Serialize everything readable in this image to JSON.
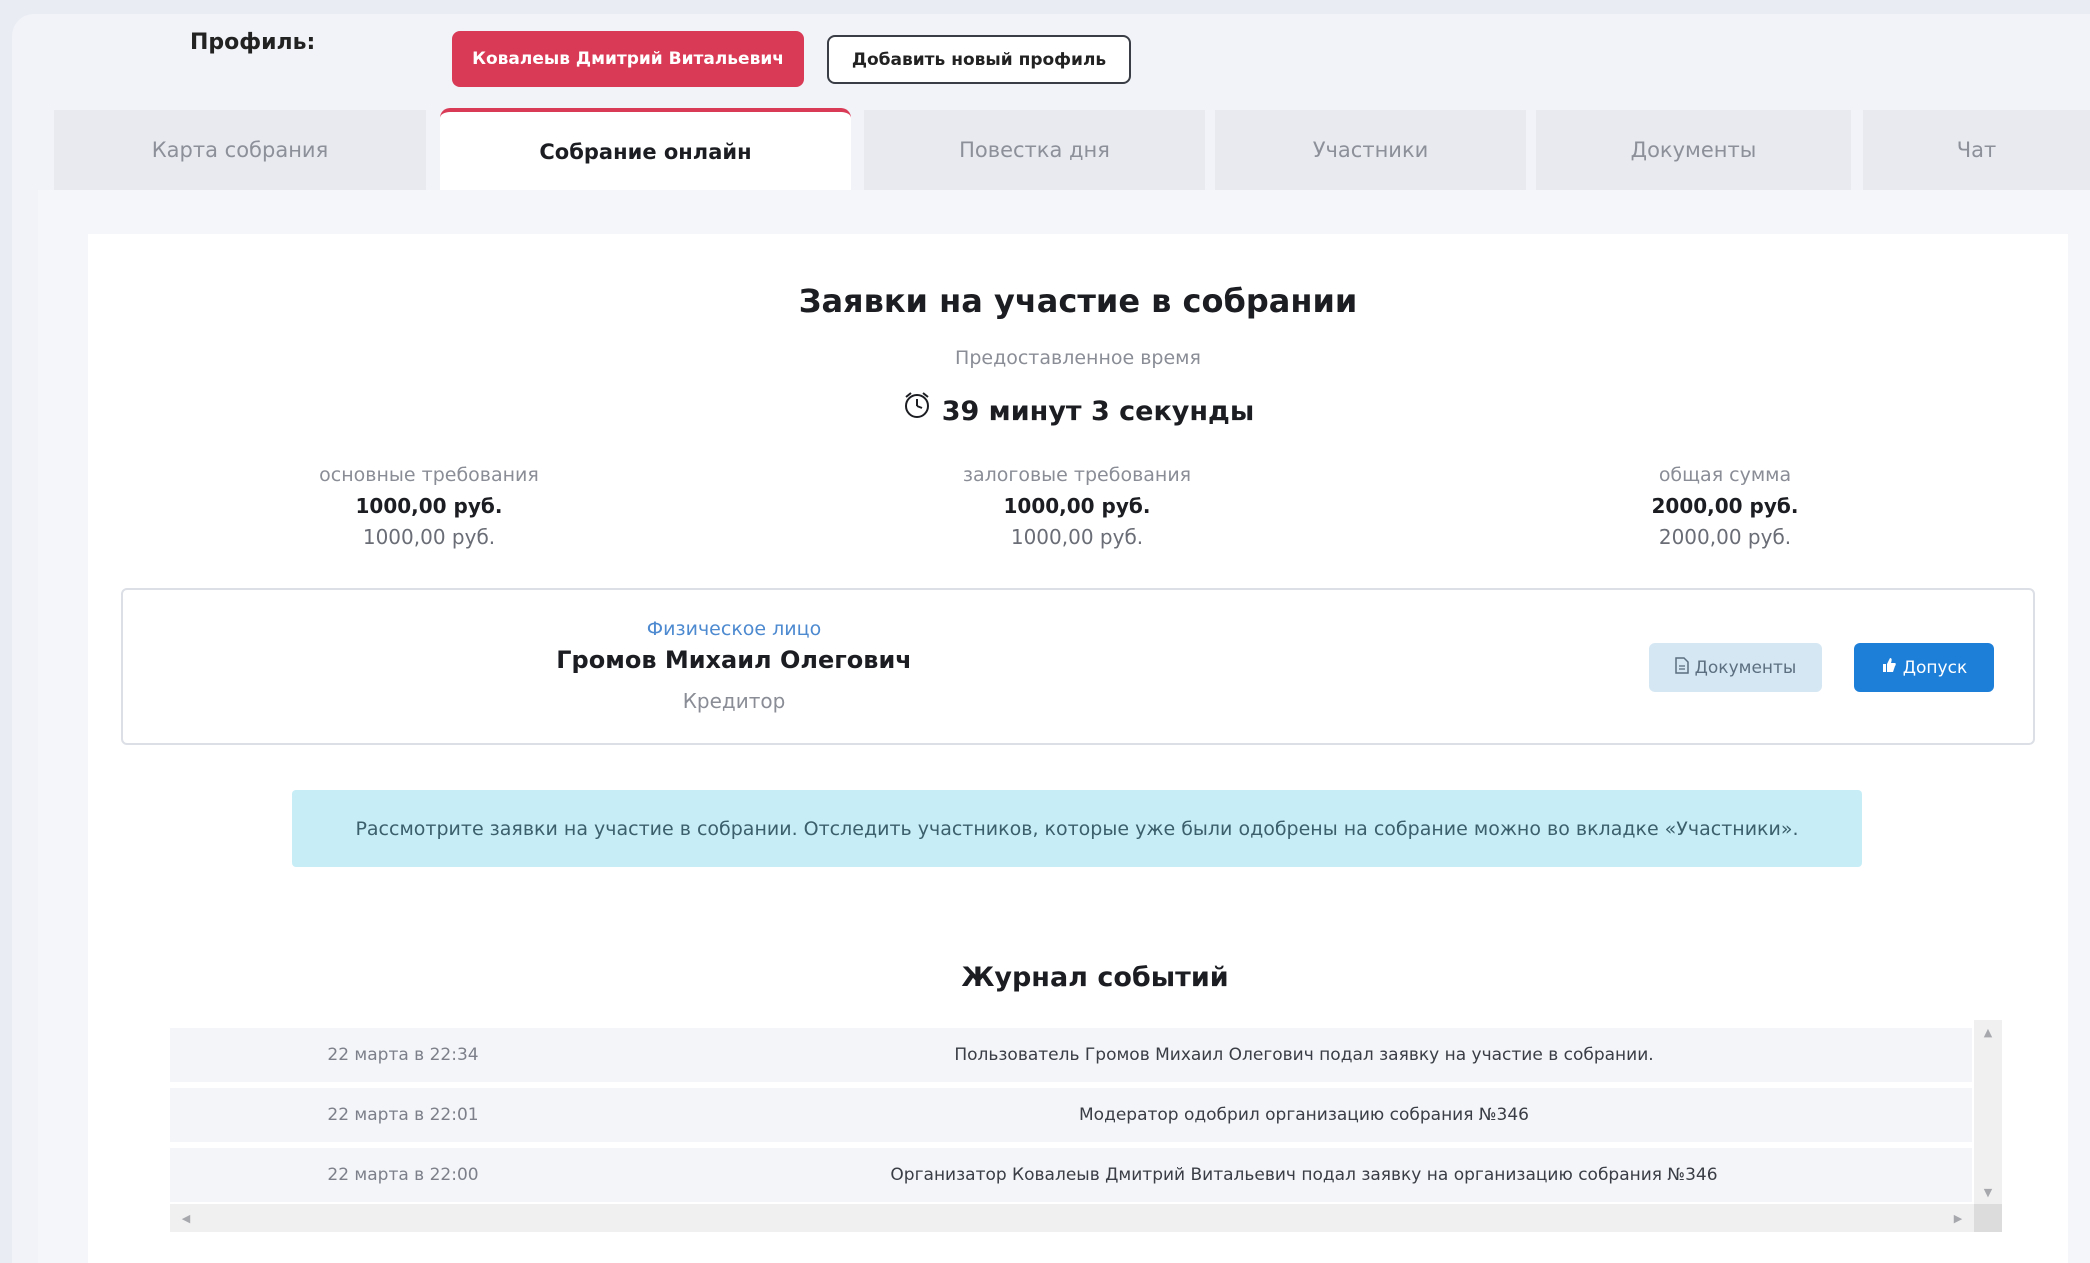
{
  "profile": {
    "label": "Профиль:",
    "current": "Ковалеыв Дмитрий Витальевич",
    "add_label": "Добавить новый профиль"
  },
  "tabs": [
    {
      "label": "Карта собрания",
      "active": false
    },
    {
      "label": "Собрание онлайн",
      "active": true
    },
    {
      "label": "Повестка дня",
      "active": false
    },
    {
      "label": "Участники",
      "active": false
    },
    {
      "label": "Документы",
      "active": false
    },
    {
      "label": "Чат",
      "active": false
    }
  ],
  "main": {
    "title": "Заявки на участие в собрании",
    "time_label": "Предоставленное время",
    "time_icon": "alarm-clock-icon",
    "time_value": "39 минут 3 секунды",
    "stats": [
      {
        "label": "основные требования",
        "value1": "1000,00 руб.",
        "value2": "1000,00 руб."
      },
      {
        "label": "залоговые требования",
        "value1": "1000,00 руб.",
        "value2": "1000,00 руб."
      },
      {
        "label": "общая сумма",
        "value1": "2000,00 руб.",
        "value2": "2000,00 руб."
      }
    ],
    "applicant": {
      "type": "Физическое лицо",
      "name": "Громов Михаил Олегович",
      "role": "Кредитор",
      "docs_label": "Документы",
      "docs_icon": "document-icon",
      "admit_label": "Допуск",
      "admit_icon": "thumbs-up-icon"
    },
    "info": "Рассмотрите заявки на участие в собрании. Отследить участников, которые уже были одобрены на собрание можно во вкладке «Участники»."
  },
  "log": {
    "title": "Журнал событий",
    "rows": [
      {
        "date": "22 марта в 22:34",
        "text": "Пользователь Громов Михаил Олегович подал заявку на участие в собрании."
      },
      {
        "date": "22 марта в 22:01",
        "text": "Модератор одобрил организацию собрания №346"
      },
      {
        "date": "22 марта в 22:00",
        "text": "Организатор Ковалеыв Дмитрий Витальевич подал заявку на организацию собрания №346"
      }
    ]
  },
  "colors": {
    "accent": "#d93a55",
    "primary_button": "#1e7fd9",
    "info_bg": "#c7eef7",
    "link": "#4d8ad0"
  }
}
